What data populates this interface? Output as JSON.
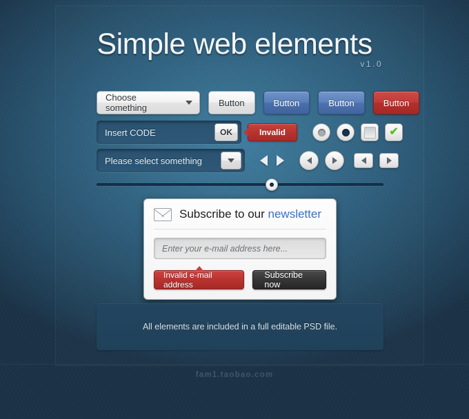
{
  "header": {
    "title": "Simple web elements",
    "version": "v1.0"
  },
  "row_buttons": {
    "dropdown_label": "Choose something",
    "dropdown_icon": "chevron-down-icon",
    "buttons": [
      {
        "label": "Button",
        "style": "light"
      },
      {
        "label": "Button",
        "style": "blue"
      },
      {
        "label": "Button",
        "style": "blue2"
      },
      {
        "label": "Button",
        "style": "red"
      }
    ]
  },
  "row_input": {
    "field_value": "Insert CODE",
    "ok_label": "OK",
    "invalid_label": "Invalid",
    "radio_off_name": "radio-unchecked",
    "radio_on_name": "radio-checked",
    "checkbox_off_name": "checkbox-unchecked",
    "checkbox_on_name": "checkbox-checked",
    "check_glyph": "✔"
  },
  "row_select": {
    "select_label": "Please select something",
    "select_icon": "chevron-down-icon",
    "arrows": [
      "triangle-left-icon",
      "triangle-right-icon",
      "circle-prev-button",
      "circle-next-button",
      "square-prev-button",
      "square-next-button"
    ]
  },
  "slider": {
    "value_percent": 61,
    "name": "range-slider"
  },
  "newsletter": {
    "icon": "envelope-icon",
    "title_prefix": "Subscribe to our ",
    "title_accent": "newsletter",
    "email_placeholder": "Enter your e-mail address here...",
    "error_label": "Invalid e-mail address",
    "submit_label": "Subscribe now"
  },
  "footer": {
    "note": "All elements are included in a full editable PSD file.",
    "watermark": "fam1.taobao.com"
  },
  "colors": {
    "bg_center": "#3f7ba0",
    "bg_edge": "#1b3246",
    "accent_blue": "#3b6fc4",
    "danger_red": "#b8332f",
    "success_green": "#63bb2a",
    "button_blue": "#4a6fab"
  }
}
